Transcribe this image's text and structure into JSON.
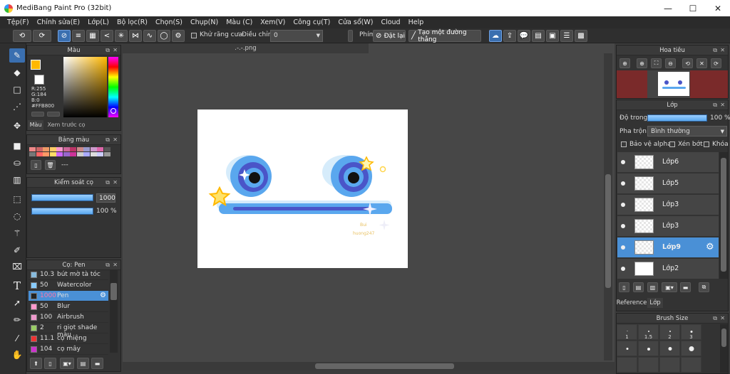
{
  "window": {
    "title": "MediBang Paint Pro (32bit)",
    "controls": [
      "—",
      "☐",
      "✕"
    ]
  },
  "menu": [
    "Tệp(F)",
    "Chỉnh sửa(E)",
    "Lớp(L)",
    "Bộ lọc(R)",
    "Chọn(S)",
    "Chụp(N)",
    "Màu (C)",
    "Xem(V)",
    "Công cụ(T)",
    "Cửa sổ(W)",
    "Cloud",
    "Help"
  ],
  "toolbar": {
    "antialias_label": "Khử răng cưa",
    "correction_label": "Điều chỉnh",
    "correction_value": "0",
    "key_label": "Phím",
    "reset_label": "Đặt lại",
    "straight_line_label": "Tạo một đường thẳng"
  },
  "color_panel": {
    "title": "Màu",
    "r": "R:255",
    "g": "G:184",
    "b": "B:0",
    "hex": "#FFB800",
    "tab_color": "Màu",
    "tab_preview": "Xem trước cọ",
    "fg_color": "#FFB800"
  },
  "palette_panel": {
    "title": "Bảng màu",
    "name": "---",
    "swatches": [
      "#e88",
      "#c66",
      "#e96",
      "#fc6",
      "#f9c",
      "#c69",
      "#b36",
      "#c88",
      "#99c",
      "#c9c",
      "#d6a",
      "#555",
      "#777",
      "#f66",
      "#f96",
      "#fd6",
      "#c6f",
      "#96c",
      "#c39",
      "#ccc",
      "#aaf",
      "#ddd",
      "#ccf",
      "#999"
    ]
  },
  "brush_control": {
    "title": "Kiểm soát cọ",
    "size": "1000",
    "opacity": "100 %"
  },
  "brush_panel": {
    "title": "Cọ: Pen",
    "items": [
      {
        "num": "10.3",
        "name": "bút mờ tà tóc",
        "color": "#8bd"
      },
      {
        "num": "50",
        "name": "Watercolor",
        "color": "#8cf"
      },
      {
        "num": "1000",
        "name": "Pen",
        "color": "#222"
      },
      {
        "num": "50",
        "name": "Blur",
        "color": "#f9c"
      },
      {
        "num": "100",
        "name": "Airbrush",
        "color": "#e9c"
      },
      {
        "num": "2",
        "name": "ri giọt shade màu",
        "color": "#9c6"
      },
      {
        "num": "11.1",
        "name": "cọ miệng",
        "color": "#e33"
      },
      {
        "num": "104",
        "name": "cọ mây",
        "color": "#c3c"
      }
    ]
  },
  "document": {
    "tab": ".-.-.png",
    "watermark_1": "Bui",
    "watermark_2": "huong247"
  },
  "navigator": {
    "title": "Hoa tiêu"
  },
  "layer_panel": {
    "title": "Lớp",
    "opacity_label": "Độ trong",
    "opacity_value": "100 %",
    "blend_label": "Pha trộn",
    "blend_value": "Bình thường",
    "protect_alpha": "Bảo vệ alpha",
    "clip": "Xén bớt",
    "lock": "Khóa",
    "layers": [
      "Lớp6",
      "Lớp5",
      "Lớp3",
      "Lớp3",
      "Lớp9",
      "Lớp2"
    ],
    "tab_reference": "Reference",
    "tab_layer": "Lớp"
  },
  "brush_size_panel": {
    "title": "Brush Size",
    "sizes": [
      "1",
      "1.5",
      "2",
      "3"
    ]
  }
}
